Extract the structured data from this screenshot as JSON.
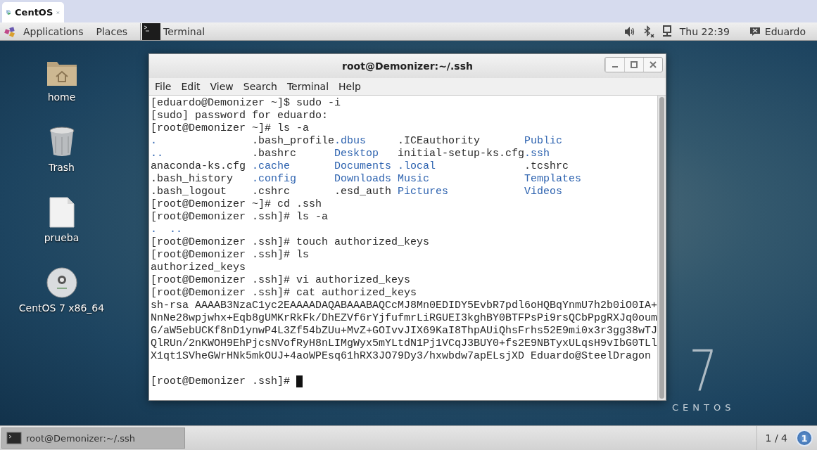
{
  "browser_tab": {
    "title": "CentOS",
    "selected": true
  },
  "top_panel": {
    "menus": [
      "Applications",
      "Places"
    ],
    "window_launcher": "Terminal",
    "clock": "Thu 22:39",
    "user": "Eduardo"
  },
  "desktop_icons": [
    {
      "label": "home",
      "kind": "folder"
    },
    {
      "label": "Trash",
      "kind": "trash"
    },
    {
      "label": "prueba",
      "kind": "file"
    },
    {
      "label": "CentOS 7 x86_64",
      "kind": "disc"
    }
  ],
  "desktop_logo": {
    "numeral": "7",
    "word": "CENTOS"
  },
  "terminal_window": {
    "title": "root@Demonizer:~/.ssh",
    "menu": [
      "File",
      "Edit",
      "View",
      "Search",
      "Terminal",
      "Help"
    ],
    "lines": [
      {
        "kind": "text",
        "segments": [
          {
            "text": "[eduardo@Demonizer ~]$ sudo -i",
            "kind": "plain"
          }
        ]
      },
      {
        "kind": "text",
        "segments": [
          {
            "text": "[sudo] password for eduardo:",
            "kind": "plain"
          }
        ]
      },
      {
        "kind": "text",
        "segments": [
          {
            "text": "[root@Demonizer ~]# ls -a",
            "kind": "plain"
          }
        ]
      },
      {
        "kind": "listing",
        "cells": [
          {
            "text": ".",
            "kind": "dir"
          },
          {
            "text": ".bash_profile",
            "kind": "plain"
          },
          {
            "text": ".dbus",
            "kind": "dir"
          },
          {
            "text": ".ICEauthority",
            "kind": "plain"
          },
          {
            "text": "Public",
            "kind": "dir"
          }
        ]
      },
      {
        "kind": "listing",
        "cells": [
          {
            "text": "..",
            "kind": "dir"
          },
          {
            "text": ".bashrc",
            "kind": "plain"
          },
          {
            "text": "Desktop",
            "kind": "dir"
          },
          {
            "text": "initial-setup-ks.cfg",
            "kind": "plain"
          },
          {
            "text": ".ssh",
            "kind": "dir"
          }
        ]
      },
      {
        "kind": "listing",
        "cells": [
          {
            "text": "anaconda-ks.cfg",
            "kind": "plain"
          },
          {
            "text": ".cache",
            "kind": "dir"
          },
          {
            "text": "Documents",
            "kind": "dir"
          },
          {
            "text": ".local",
            "kind": "dir"
          },
          {
            "text": ".tcshrc",
            "kind": "plain"
          }
        ]
      },
      {
        "kind": "listing",
        "cells": [
          {
            "text": ".bash_history",
            "kind": "plain"
          },
          {
            "text": ".config",
            "kind": "dir"
          },
          {
            "text": "Downloads",
            "kind": "dir"
          },
          {
            "text": "Music",
            "kind": "dir"
          },
          {
            "text": "Templates",
            "kind": "dir"
          }
        ]
      },
      {
        "kind": "listing",
        "cells": [
          {
            "text": ".bash_logout",
            "kind": "plain"
          },
          {
            "text": ".cshrc",
            "kind": "plain"
          },
          {
            "text": ".esd_auth",
            "kind": "plain"
          },
          {
            "text": "Pictures",
            "kind": "dir"
          },
          {
            "text": "Videos",
            "kind": "dir"
          }
        ]
      },
      {
        "kind": "text",
        "segments": [
          {
            "text": "[root@Demonizer ~]# cd .ssh",
            "kind": "plain"
          }
        ]
      },
      {
        "kind": "text",
        "segments": [
          {
            "text": "[root@Demonizer .ssh]# ls -a",
            "kind": "plain"
          }
        ]
      },
      {
        "kind": "text",
        "segments": [
          {
            "text": ".  ..",
            "kind": "dir"
          }
        ]
      },
      {
        "kind": "text",
        "segments": [
          {
            "text": "[root@Demonizer .ssh]# touch authorized_keys",
            "kind": "plain"
          }
        ]
      },
      {
        "kind": "text",
        "segments": [
          {
            "text": "[root@Demonizer .ssh]# ls",
            "kind": "plain"
          }
        ]
      },
      {
        "kind": "text",
        "segments": [
          {
            "text": "authorized_keys",
            "kind": "plain"
          }
        ]
      },
      {
        "kind": "text",
        "segments": [
          {
            "text": "[root@Demonizer .ssh]# vi authorized_keys",
            "kind": "plain"
          }
        ]
      },
      {
        "kind": "text",
        "segments": [
          {
            "text": "[root@Demonizer .ssh]# cat authorized_keys",
            "kind": "plain"
          }
        ]
      },
      {
        "kind": "text",
        "segments": [
          {
            "text": "sh-rsa AAAAB3NzaC1yc2EAAAADAQABAAABAQCcMJ8Mn0EDIDY5EvbR7pdl6oHQBqYnmU7h2b0iO0IA+",
            "kind": "plain"
          }
        ]
      },
      {
        "kind": "text",
        "segments": [
          {
            "text": "NnNe28wpjwhx+Eqb8gUMKrRkFk/DhEZVf6rYjfufmrLiRGUEI3kghBY0BTFPsPi9rsQCbPpgRXJq0oum",
            "kind": "plain"
          }
        ]
      },
      {
        "kind": "text",
        "segments": [
          {
            "text": "G/aW5ebUCKf8nD1ynwP4L3Zf54bZUu+MvZ+GOIvvJIX69KaI8ThpAUiQhsFrhs52E9mi0x3r3gg38wTJ",
            "kind": "plain"
          }
        ]
      },
      {
        "kind": "text",
        "segments": [
          {
            "text": "QlRUn/2nKWOH9EhPjcsNVofRyH8nLIMgWyx5mYLtdN1Pj1VCqJ3BUY0+fs2E9NBTyxULqsH9vIbG0TLl",
            "kind": "plain"
          }
        ]
      },
      {
        "kind": "text",
        "segments": [
          {
            "text": "X1qt1SVheGWrHNk5mkOUJ+4aoWPEsq61hRX3JO79Dy3/hxwbdw7apELsjXD Eduardo@SteelDragon",
            "kind": "plain"
          }
        ]
      },
      {
        "kind": "blank"
      },
      {
        "kind": "prompt",
        "text": "[root@Demonizer .ssh]# ",
        "cursor": true
      }
    ]
  },
  "taskbar": {
    "tasks": [
      {
        "label": "root@Demonizer:~/.ssh",
        "selected": true
      }
    ],
    "workspace": "1 / 4",
    "notifications": "1"
  }
}
